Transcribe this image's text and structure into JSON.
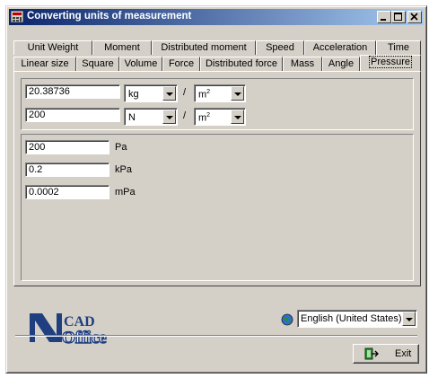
{
  "window": {
    "title": "Converting units of measurement"
  },
  "tabs_top": [
    "Unit Weight",
    "Moment",
    "Distributed moment",
    "Speed",
    "Acceleration",
    "Time"
  ],
  "tabs_bottom": [
    "Linear size",
    "Square",
    "Volume",
    "Force",
    "Distributed force",
    "Mass",
    "Angle",
    "Pressure"
  ],
  "active_tab": "Pressure",
  "inputs": {
    "row1": {
      "value": "20.38736",
      "unit_num": "kg",
      "separator": "/",
      "unit_den": "m",
      "exp": "2"
    },
    "row2": {
      "value": "200",
      "unit_num": "N",
      "separator": "/",
      "unit_den": "m",
      "exp": "2"
    }
  },
  "results": [
    {
      "value": "200",
      "unit": "Pa"
    },
    {
      "value": "0.2",
      "unit": "kPa"
    },
    {
      "value": "0.0002",
      "unit": "mPa"
    }
  ],
  "language": {
    "selected": "English (United States)"
  },
  "buttons": {
    "exit": "Exit"
  },
  "icons": [
    "app-icon",
    "minimize-icon",
    "maximize-icon",
    "close-icon",
    "dropdown-arrow-icon",
    "language-icon",
    "exit-icon",
    "scad-office-logo"
  ],
  "colors": {
    "titlebar_start": "#0a246a",
    "titlebar_end": "#a6caf0",
    "face": "#d4d0c8",
    "logo": "#1f3f80"
  }
}
